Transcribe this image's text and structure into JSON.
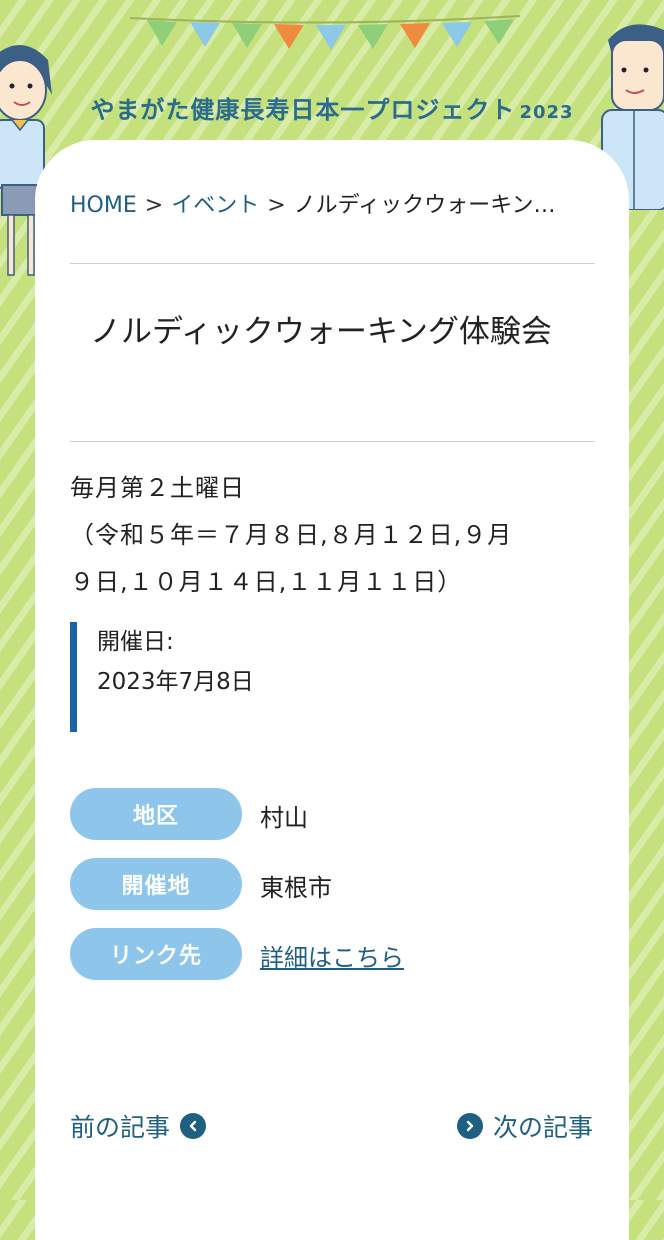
{
  "site": {
    "title": "やまがた健康長寿日本一プロジェクト",
    "year": "2023"
  },
  "breadcrumb": {
    "home": "HOME",
    "events": "イベント",
    "current": "ノルディックウォーキン…",
    "separator": ">"
  },
  "article": {
    "title": "ノルディックウォーキング体験会",
    "description_lines": [
      "毎月第２土曜日",
      "（令和５年＝７月８日,８月１２日,９月",
      "９日,１０月１４日,１１月１１日）"
    ],
    "date_label": "開催日:",
    "date_value": "2023年7月8日"
  },
  "info": [
    {
      "label": "地区",
      "value": "村山"
    },
    {
      "label": "開催地",
      "value": "東根市"
    },
    {
      "label": "リンク先",
      "value": "詳細はこちら"
    }
  ],
  "navigation": {
    "prev": "前の記事",
    "next": "次の記事"
  },
  "colors": {
    "background": "#c5e17d",
    "accent": "#1f5f82",
    "pill": "#8ec5ea",
    "date_bar": "#1a64a6"
  },
  "icons": {
    "prev": "chevron-left-icon",
    "next": "chevron-right-icon"
  }
}
